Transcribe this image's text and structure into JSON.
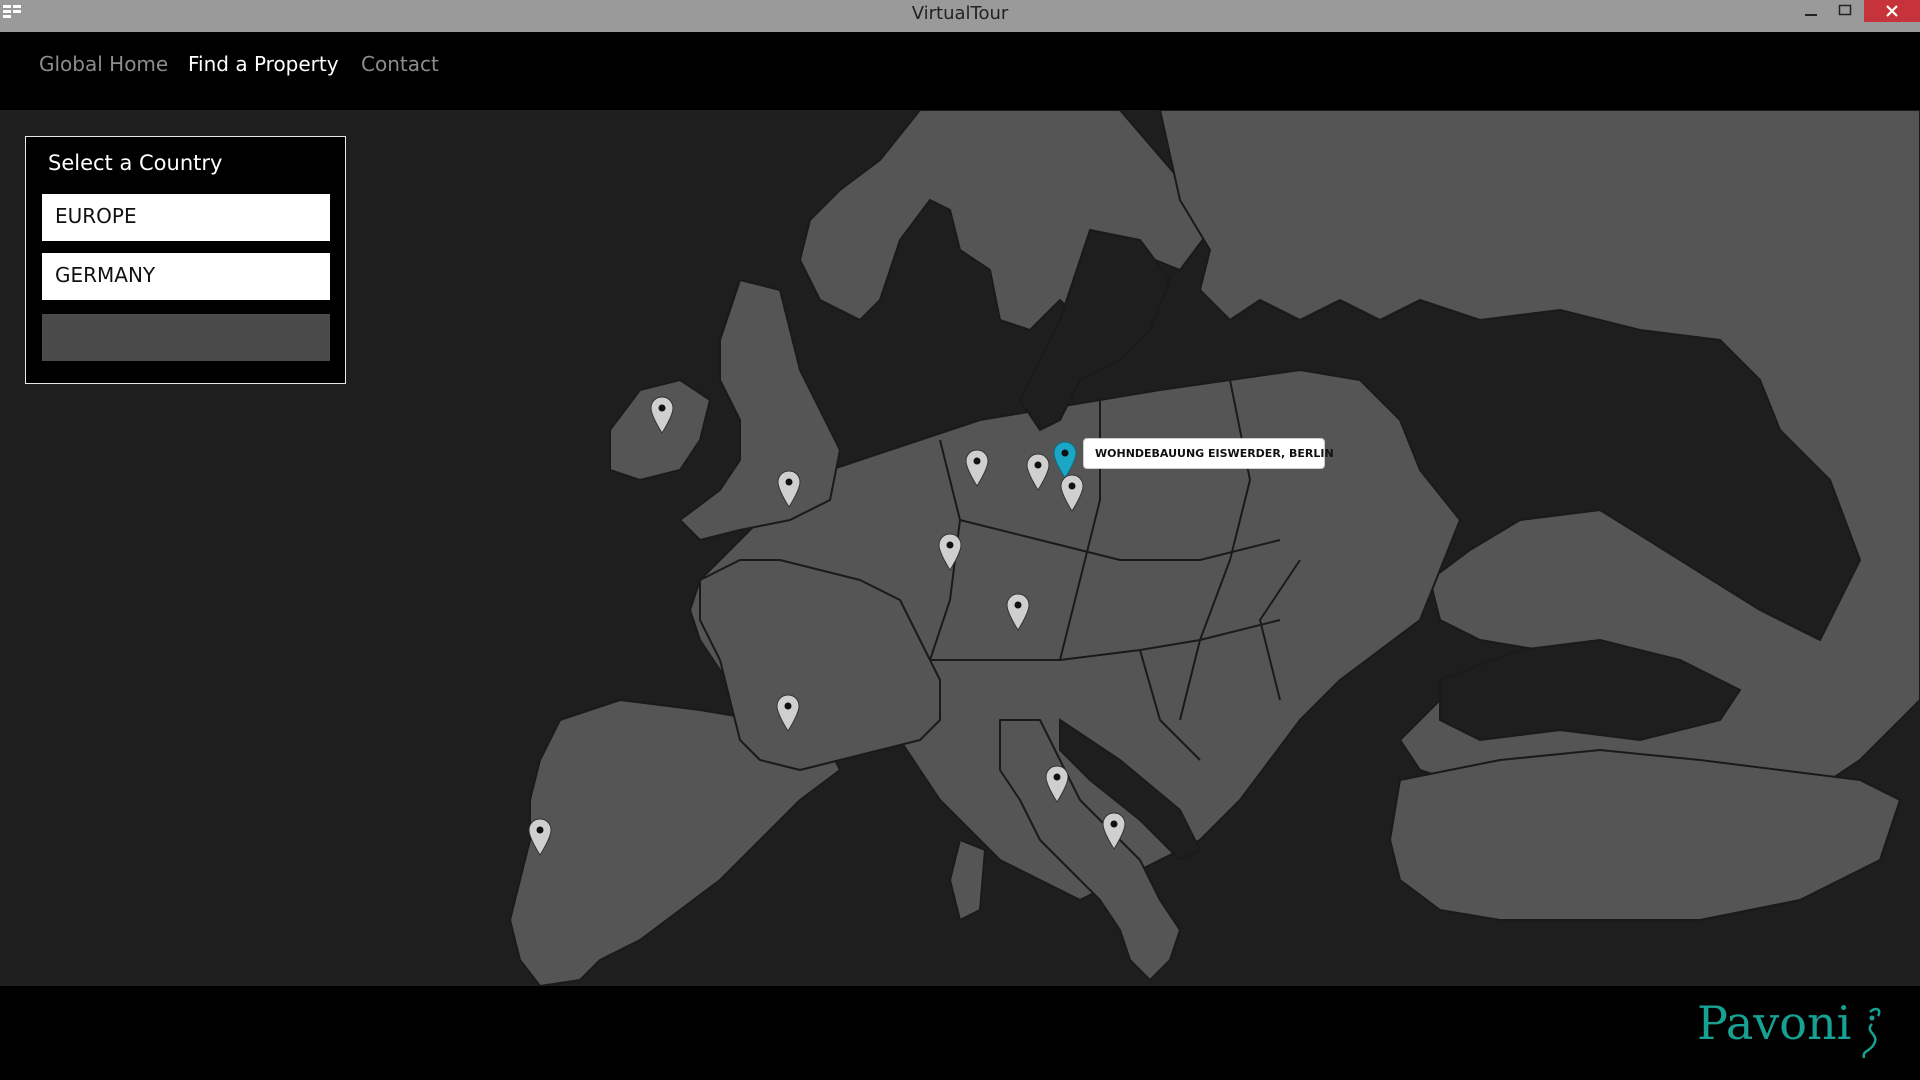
{
  "window": {
    "title": "VirtualTour",
    "minimize": "—",
    "maximize": "☐",
    "close": "✕"
  },
  "nav": {
    "items": [
      "Global Home",
      "Find a Property",
      "Contact"
    ],
    "active": "Find a Property"
  },
  "panel": {
    "title": "Select a Country",
    "region_value": "EUROPE",
    "country_value": "GERMANY",
    "city_value": ""
  },
  "map": {
    "selected_property": "WOHNDEBAUUNG EISWERDER, BERLIN",
    "colors": {
      "sea": "#1e1e1e",
      "land": "#555555",
      "border": "#1a1a1a",
      "pin": "#cfcfcf",
      "pin_active": "#1aa6c4"
    },
    "pins": [
      {
        "name": "Ireland",
        "active": false
      },
      {
        "name": "England",
        "active": false
      },
      {
        "name": "Netherlands",
        "active": false
      },
      {
        "name": "Hamburg",
        "active": false
      },
      {
        "name": "Berlin",
        "active": true
      },
      {
        "name": "Brandenburg",
        "active": false
      },
      {
        "name": "Cologne",
        "active": false
      },
      {
        "name": "Stuttgart",
        "active": false
      },
      {
        "name": "Bordeaux",
        "active": false
      },
      {
        "name": "Lisbon",
        "active": false
      },
      {
        "name": "Rome",
        "active": false
      },
      {
        "name": "Naples",
        "active": false
      }
    ]
  },
  "footer": {
    "logo_text": "Pavoni",
    "logo_color": "#17a192"
  }
}
